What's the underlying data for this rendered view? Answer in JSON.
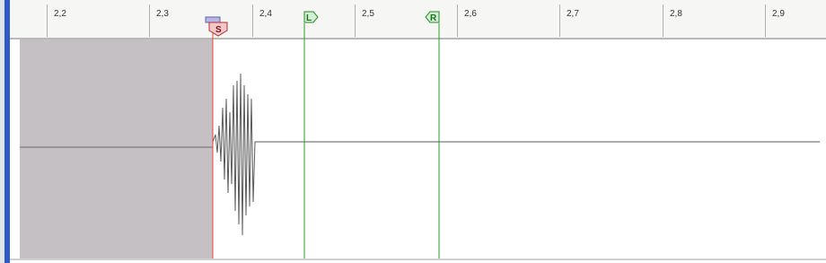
{
  "ruler": {
    "ticks": [
      {
        "label": "2,2"
      },
      {
        "label": "2,3"
      },
      {
        "label": "2,4"
      },
      {
        "label": "2,5"
      },
      {
        "label": "2,6"
      },
      {
        "label": "2,7"
      },
      {
        "label": "2,8"
      },
      {
        "label": "2,9"
      }
    ]
  },
  "markers": {
    "start": {
      "label": "S",
      "time": 2.36
    },
    "left": {
      "label": "L",
      "time": 2.45
    },
    "right": {
      "label": "R",
      "time": 2.58
    }
  },
  "colors": {
    "start_line": "#e8443a",
    "loop_line": "#2a9d2a",
    "selection": "#c4c0c4",
    "waveform": "#5a5a5a",
    "ruler_bg": "#f6f6f4",
    "left_accent": "#2f59c7"
  }
}
